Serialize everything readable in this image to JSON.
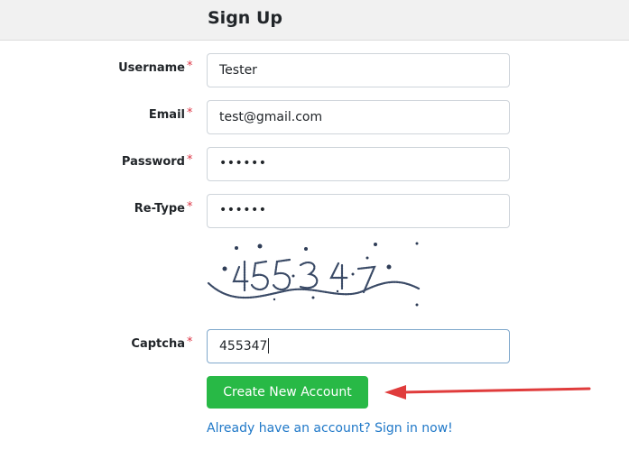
{
  "header": {
    "title": "Sign Up"
  },
  "form": {
    "required_marker": "*",
    "username": {
      "label": "Username",
      "value": "Tester"
    },
    "email": {
      "label": "Email",
      "value": "test@gmail.com"
    },
    "password": {
      "label": "Password",
      "value": "••••••"
    },
    "retype": {
      "label": "Re-Type",
      "value": "••••••"
    },
    "captcha": {
      "label": "Captcha",
      "value": "455347"
    },
    "submit_label": "Create New Account",
    "signin_link": "Already have an account? Sign in now!"
  },
  "colors": {
    "submit_button": "#28b946",
    "link": "#1f78c8",
    "required": "#dc3545",
    "annotation_arrow": "#e03c3c"
  },
  "annotation": {
    "icon": "red-arrow-icon"
  }
}
